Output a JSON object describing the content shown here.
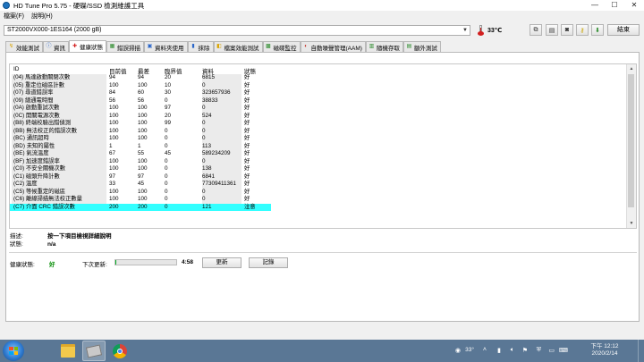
{
  "window": {
    "title": "HD Tune Pro 5.75 - 硬碟/SSD 檢測維護工具",
    "minimize": "—",
    "maximize": "☐",
    "close": "✕"
  },
  "menu": [
    "檔案(F)",
    "說明(H)"
  ],
  "toolbar": {
    "drive": "ST2000VX000-1ES164 (2000 gB)",
    "temperature": "33℃",
    "exit_label": "結束"
  },
  "tabs": [
    {
      "label": "效能測試",
      "icon": "benchmark-icon"
    },
    {
      "label": "資訊",
      "icon": "info-icon"
    },
    {
      "label": "健康狀態",
      "icon": "health-cross-icon",
      "active": true
    },
    {
      "label": "錯誤掃描",
      "icon": "error-scan-icon"
    },
    {
      "label": "資料夾使用",
      "icon": "folder-usage-icon"
    },
    {
      "label": "抹除",
      "icon": "erase-icon"
    },
    {
      "label": "檔案效能測試",
      "icon": "file-benchmark-icon"
    },
    {
      "label": "磁碟監控",
      "icon": "disk-monitor-icon"
    },
    {
      "label": "自動噪聲管理(AAM)",
      "icon": "aam-icon"
    },
    {
      "label": "隨機存取",
      "icon": "random-access-icon"
    },
    {
      "label": "額外測試",
      "icon": "extra-tests-icon"
    }
  ],
  "table": {
    "headers": {
      "id": "ID",
      "current": "目前值",
      "worst": "最差",
      "threshold": "臨界值",
      "data": "資料",
      "status": "狀態"
    },
    "rows": [
      {
        "id": "(04) 馬達啟動關閉次數",
        "current": "94",
        "worst": "94",
        "threshold": "20",
        "data": "6815",
        "status": "好"
      },
      {
        "id": "(05) 重定位磁區計數",
        "current": "100",
        "worst": "100",
        "threshold": "10",
        "data": "0",
        "status": "好"
      },
      {
        "id": "(07) 尋道錯誤率",
        "current": "84",
        "worst": "60",
        "threshold": "30",
        "data": "323657936",
        "status": "好"
      },
      {
        "id": "(09) 總通電時間",
        "current": "56",
        "worst": "56",
        "threshold": "0",
        "data": "38833",
        "status": "好"
      },
      {
        "id": "(0A) 啟動重試次數",
        "current": "100",
        "worst": "100",
        "threshold": "97",
        "data": "0",
        "status": "好"
      },
      {
        "id": "(0C) 開關電源次數",
        "current": "100",
        "worst": "100",
        "threshold": "20",
        "data": "524",
        "status": "好"
      },
      {
        "id": "(B8) 終端校驗出錯偵測",
        "current": "100",
        "worst": "100",
        "threshold": "99",
        "data": "0",
        "status": "好"
      },
      {
        "id": "(BB) 無法校正的錯誤次數",
        "current": "100",
        "worst": "100",
        "threshold": "0",
        "data": "0",
        "status": "好"
      },
      {
        "id": "(BC) 通訊超時",
        "current": "100",
        "worst": "100",
        "threshold": "0",
        "data": "0",
        "status": "好"
      },
      {
        "id": "(BD) 未知的屬性",
        "current": "1",
        "worst": "1",
        "threshold": "0",
        "data": "113",
        "status": "好"
      },
      {
        "id": "(BE) 氣流溫度",
        "current": "67",
        "worst": "55",
        "threshold": "45",
        "data": "589234209",
        "status": "好"
      },
      {
        "id": "(BF) 加速度錯誤率",
        "current": "100",
        "worst": "100",
        "threshold": "0",
        "data": "0",
        "status": "好"
      },
      {
        "id": "(C0) 不安全關機次數",
        "current": "100",
        "worst": "100",
        "threshold": "0",
        "data": "138",
        "status": "好"
      },
      {
        "id": "(C1) 磁頭升降計數",
        "current": "97",
        "worst": "97",
        "threshold": "0",
        "data": "6841",
        "status": "好"
      },
      {
        "id": "(C2) 溫度",
        "current": "33",
        "worst": "45",
        "threshold": "0",
        "data": "77309411361",
        "status": "好"
      },
      {
        "id": "(C5) 等候重定的磁區",
        "current": "100",
        "worst": "100",
        "threshold": "0",
        "data": "0",
        "status": "好"
      },
      {
        "id": "(C6) 離線掃描無法校正數量",
        "current": "100",
        "worst": "100",
        "threshold": "0",
        "data": "0",
        "status": "好"
      },
      {
        "id": "(C7) 介面 CRC 錯誤次數",
        "current": "200",
        "worst": "200",
        "threshold": "0",
        "data": "121",
        "status": "注意",
        "highlight": true
      }
    ]
  },
  "details": {
    "description_label": "描述:",
    "description_value": "按一下項目檢視詳細說明",
    "status_label": "狀態:",
    "status_value": "n/a"
  },
  "health": {
    "label": "健康狀態:",
    "value": "好",
    "next_update_label": "下次更新:",
    "countdown": "4:58",
    "progress_fraction": 0.02,
    "refresh_label": "更新",
    "log_label": "記錄"
  },
  "taskbar": {
    "apps": [
      "start-orb",
      "explorer-icon",
      "hdtune-icon",
      "chrome-icon"
    ],
    "tray_temp": "33°",
    "time": "下午 12:12",
    "date": "2020/2/14"
  }
}
